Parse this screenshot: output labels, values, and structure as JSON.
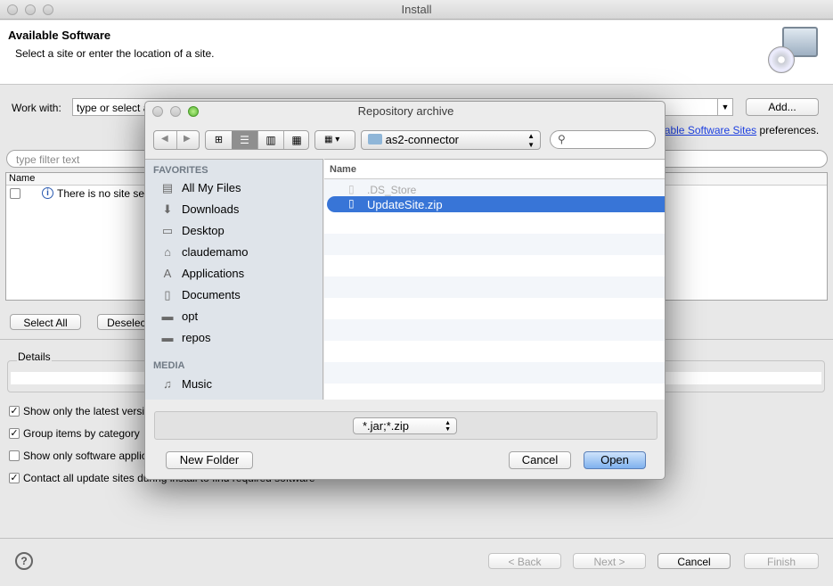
{
  "window": {
    "title": "Install"
  },
  "header": {
    "title": "Available Software",
    "subtitle": "Select a site or enter the location of a site."
  },
  "work_with": {
    "label": "Work with:",
    "placeholder": "type or select a site",
    "add_label": "Add...",
    "link": "Available Software Sites",
    "link_suffix": " preferences."
  },
  "filter": {
    "placeholder": "type filter text"
  },
  "table": {
    "column": "Name",
    "message": "There is no site selected."
  },
  "buttons": {
    "select_all": "Select All",
    "deselect_all": "Deselect All"
  },
  "details": {
    "label": "Details"
  },
  "options": [
    {
      "label": "Show only the latest versions of available software",
      "checked": true
    },
    {
      "label": "Group items by category",
      "checked": true
    },
    {
      "label": "Show only software applicable to target environment",
      "checked": false
    },
    {
      "label": "Contact all update sites during install to find required software",
      "checked": true
    }
  ],
  "footer": {
    "back": "< Back",
    "next": "Next >",
    "cancel": "Cancel",
    "finish": "Finish"
  },
  "dialog": {
    "title": "Repository archive",
    "folder": "as2-connector",
    "search_placeholder": "",
    "favorites_header": "FAVORITES",
    "favorites": [
      {
        "label": "All My Files",
        "icon": "all-files-icon"
      },
      {
        "label": "Downloads",
        "icon": "downloads-icon"
      },
      {
        "label": "Desktop",
        "icon": "desktop-icon"
      },
      {
        "label": "claudemamo",
        "icon": "home-icon"
      },
      {
        "label": "Applications",
        "icon": "applications-icon"
      },
      {
        "label": "Documents",
        "icon": "documents-icon"
      },
      {
        "label": "opt",
        "icon": "folder-icon"
      },
      {
        "label": "repos",
        "icon": "folder-icon"
      }
    ],
    "media_header": "MEDIA",
    "media": [
      {
        "label": "Music",
        "icon": "music-icon"
      }
    ],
    "column": "Name",
    "files": [
      {
        "name": ".DS_Store",
        "disabled": true,
        "selected": false
      },
      {
        "name": "UpdateSite.zip",
        "disabled": false,
        "selected": true
      }
    ],
    "filter_type": "*.jar;*.zip",
    "new_folder": "New Folder",
    "cancel": "Cancel",
    "open": "Open",
    "selection_color": "#3875d7"
  }
}
